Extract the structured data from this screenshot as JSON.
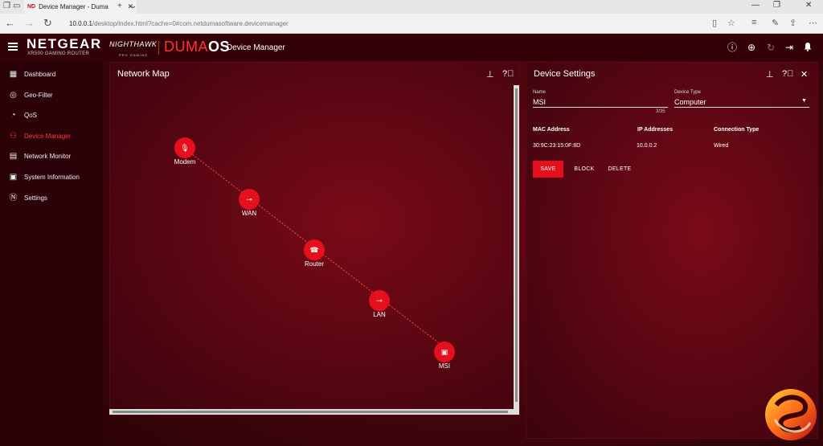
{
  "browser": {
    "tab_title": "Device Manager - Duma",
    "tab_favicon": "ND",
    "url_host": "10.0.0.1",
    "url_path": "/desktop/index.html?cache=0#com.netdumasoftware.devicemanager"
  },
  "header": {
    "brand": "NETGEAR",
    "brand_sub": "XR500 GAMING ROUTER",
    "nighthawk": "NIGHTHAWK",
    "nighthawk_sub": "PRO GAMING",
    "duma_a": "DUMA",
    "duma_b": "OS",
    "page_title": "Device Manager"
  },
  "sidebar": {
    "items": [
      {
        "label": "Dashboard",
        "icon": "dashboard-icon"
      },
      {
        "label": "Geo-Filter",
        "icon": "geo-filter-icon"
      },
      {
        "label": "QoS",
        "icon": "qos-icon"
      },
      {
        "label": "Device Manager",
        "icon": "device-manager-icon",
        "active": true
      },
      {
        "label": "Network Monitor",
        "icon": "network-monitor-icon"
      },
      {
        "label": "System Information",
        "icon": "system-info-icon"
      },
      {
        "label": "Settings",
        "icon": "settings-icon"
      }
    ]
  },
  "network_map": {
    "title": "Network Map",
    "nodes": [
      {
        "label": "Modem",
        "icon": "modem-icon"
      },
      {
        "label": "WAN",
        "icon": "ethernet-icon"
      },
      {
        "label": "Router",
        "icon": "router-icon"
      },
      {
        "label": "LAN",
        "icon": "ethernet-icon"
      },
      {
        "label": "MSI",
        "icon": "computer-icon"
      }
    ]
  },
  "device_settings": {
    "title": "Device Settings",
    "name_label": "Name",
    "name_value": "MSI",
    "name_count": "3/35",
    "type_label": "Device Type",
    "type_value": "Computer",
    "col_mac": "MAC Address",
    "col_ip": "IP Addresses",
    "col_conn": "Connection Type",
    "mac": "30:9C:23:15:0F:8D",
    "ip": "10.0.0.2",
    "conn": "Wired",
    "save": "SAVE",
    "block": "BLOCK",
    "delete": "DELETE"
  },
  "colors": {
    "accent": "#e5101c",
    "background": "#2a0206"
  }
}
